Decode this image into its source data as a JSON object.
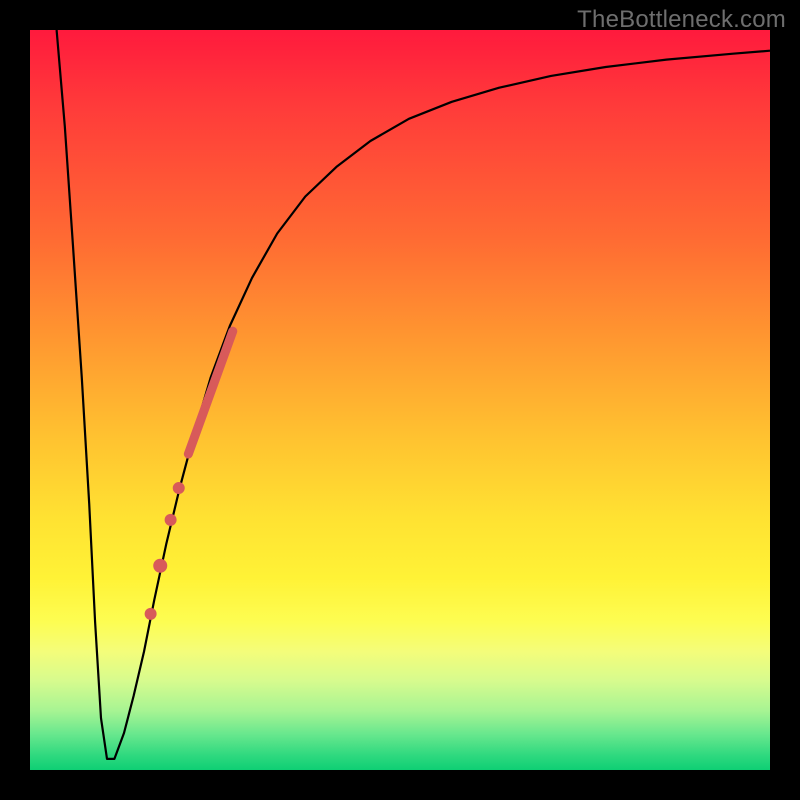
{
  "watermark": "TheBottleneck.com",
  "chart_data": {
    "type": "line",
    "title": "",
    "xlabel": "",
    "ylabel": "",
    "xlim": [
      0,
      100
    ],
    "ylim": [
      0,
      100
    ],
    "background_gradient": {
      "top_color": "#ff1a3d",
      "mid_color": "#ffe232",
      "bottom_color": "#0ecf74"
    },
    "series": [
      {
        "name": "bottleneck-curve",
        "color": "#000000",
        "x": [
          3.6,
          4.7,
          5.8,
          7.0,
          8.0,
          8.8,
          9.6,
          10.4,
          11.4,
          12.7,
          14.0,
          15.4,
          16.8,
          18.4,
          20.2,
          22.2,
          24.4,
          27.0,
          30.0,
          33.4,
          37.2,
          41.4,
          46.0,
          51.2,
          57.0,
          63.4,
          70.4,
          77.8,
          86.0,
          95.0,
          100.0
        ],
        "values": [
          100.0,
          87.0,
          71.0,
          53.0,
          36.0,
          20.0,
          7.0,
          1.5,
          1.5,
          5.0,
          10.0,
          16.0,
          23.0,
          30.5,
          38.0,
          45.5,
          53.0,
          60.0,
          66.5,
          72.5,
          77.5,
          81.5,
          85.0,
          88.0,
          90.3,
          92.2,
          93.8,
          95.0,
          96.0,
          96.8,
          97.2
        ]
      }
    ],
    "markers": [
      {
        "name": "segment-a",
        "type": "line",
        "color": "#d85a5a",
        "width": 9,
        "x": [
          21.4,
          27.4
        ],
        "y": [
          42.7,
          59.3
        ]
      },
      {
        "name": "dot-1",
        "type": "point",
        "color": "#d85a5a",
        "r": 6,
        "x": 20.1,
        "y": 38.1
      },
      {
        "name": "dot-2",
        "type": "point",
        "color": "#d85a5a",
        "r": 6,
        "x": 19.0,
        "y": 33.8
      },
      {
        "name": "dot-3",
        "type": "point",
        "color": "#d85a5a",
        "r": 7,
        "x": 17.6,
        "y": 27.6
      },
      {
        "name": "dot-4",
        "type": "point",
        "color": "#d85a5a",
        "r": 6,
        "x": 16.3,
        "y": 21.1
      }
    ]
  }
}
